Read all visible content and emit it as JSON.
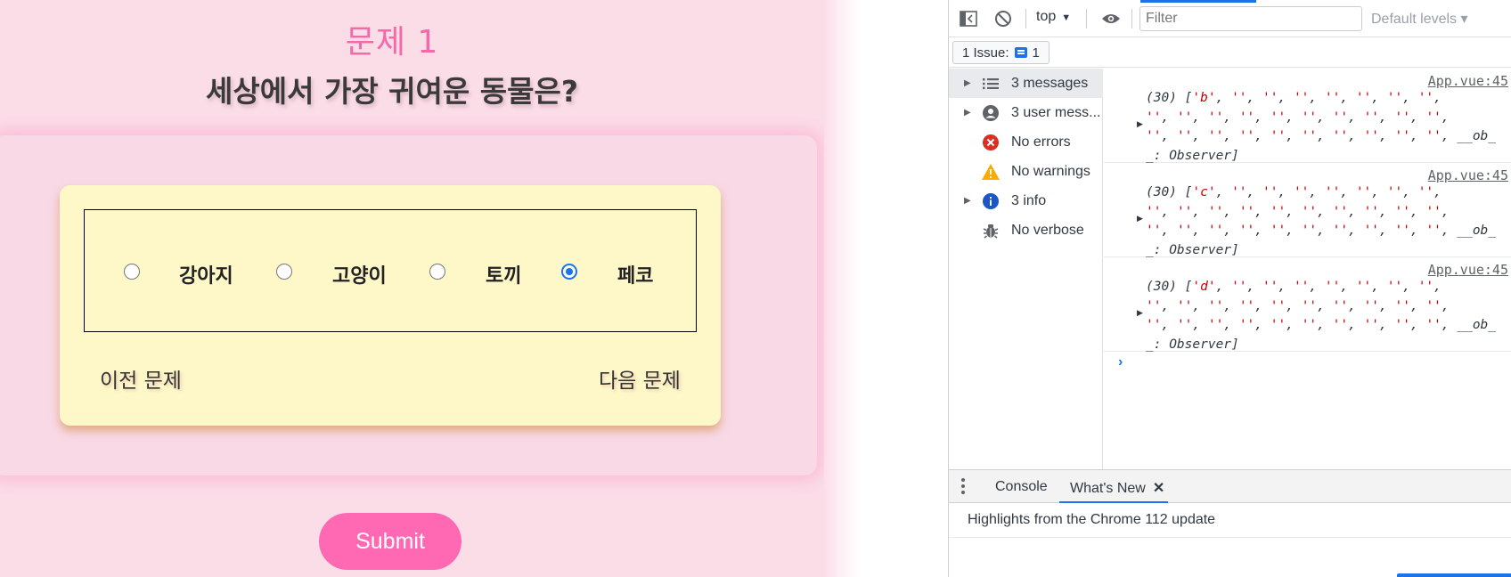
{
  "app": {
    "question_number": "문제 1",
    "question_text": "세상에서 가장 귀여운 동물은?",
    "options": [
      {
        "label": "강아지",
        "checked": false
      },
      {
        "label": "고양이",
        "checked": false
      },
      {
        "label": "토끼",
        "checked": false
      },
      {
        "label": "페코",
        "checked": true
      }
    ],
    "prev_label": "이전 문제",
    "next_label": "다음 문제",
    "submit_label": "Submit",
    "colors": {
      "background": "#fbdde8",
      "accent": "#ff69b4",
      "card": "#fef8c8"
    }
  },
  "devtools": {
    "toolbar": {
      "context": "top",
      "filter_placeholder": "Filter",
      "levels": "Default levels ▾",
      "icons": [
        "sidebar-toggle-icon",
        "clear-console-icon",
        "eye-icon"
      ]
    },
    "issues": {
      "label": "1 Issue:",
      "count": "1"
    },
    "sidebar": [
      {
        "label": "3 messages",
        "icon": "list-icon",
        "expandable": true,
        "selected": true
      },
      {
        "label": "3 user mess...",
        "icon": "user-icon",
        "expandable": true,
        "selected": false
      },
      {
        "label": "No errors",
        "icon": "error-icon",
        "expandable": false,
        "selected": false
      },
      {
        "label": "No warnings",
        "icon": "warning-icon",
        "expandable": false,
        "selected": false
      },
      {
        "label": "3 info",
        "icon": "info-icon",
        "expandable": true,
        "selected": false
      },
      {
        "label": "No verbose",
        "icon": "bug-icon",
        "expandable": false,
        "selected": false
      }
    ],
    "logs": [
      {
        "source": "App.vue:45",
        "first": "b"
      },
      {
        "source": "App.vue:45",
        "first": "c"
      },
      {
        "source": "App.vue:45",
        "first": "d"
      }
    ],
    "drawer": {
      "tabs": [
        {
          "label": "Console",
          "active": false
        },
        {
          "label": "What's New",
          "active": true,
          "closable": true
        }
      ],
      "close_glyph": "✕",
      "highlights": "Highlights from the Chrome 112 update"
    }
  }
}
